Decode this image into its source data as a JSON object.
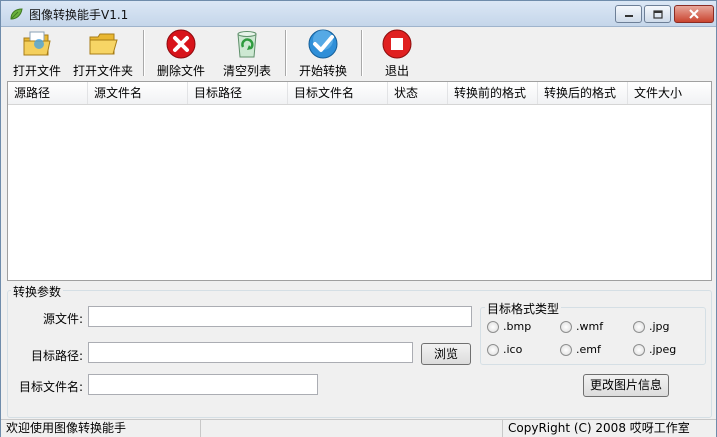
{
  "window": {
    "title": "图像转换能手V1.1"
  },
  "toolbar": {
    "open_file": "打开文件",
    "open_folder": "打开文件夹",
    "delete_file": "删除文件",
    "clear_list": "清空列表",
    "start_convert": "开始转换",
    "exit": "退出"
  },
  "list": {
    "columns": [
      "源路径",
      "源文件名",
      "目标路径",
      "目标文件名",
      "状态",
      "转换前的格式",
      "转换后的格式",
      "文件大小"
    ]
  },
  "params": {
    "title": "转换参数",
    "source_file_label": "源文件:",
    "source_file_value": "",
    "target_path_label": "目标路径:",
    "target_path_value": "",
    "browse": "浏览",
    "target_name_label": "目标文件名:",
    "target_name_value": "",
    "change_info": "更改图片信息"
  },
  "format": {
    "title": "目标格式类型",
    "options": [
      ".bmp",
      ".wmf",
      ".jpg",
      ".ico",
      ".emf",
      ".jpeg"
    ]
  },
  "status": {
    "left": "欢迎使用图像转换能手",
    "right": "CopyRight (C) 2008 哎呀工作室"
  },
  "colors": {
    "delete_red": "#d8141b",
    "exit_red": "#e02020",
    "check_blue": "#2f8fd8",
    "folder_yellow": "#f2c94c"
  }
}
